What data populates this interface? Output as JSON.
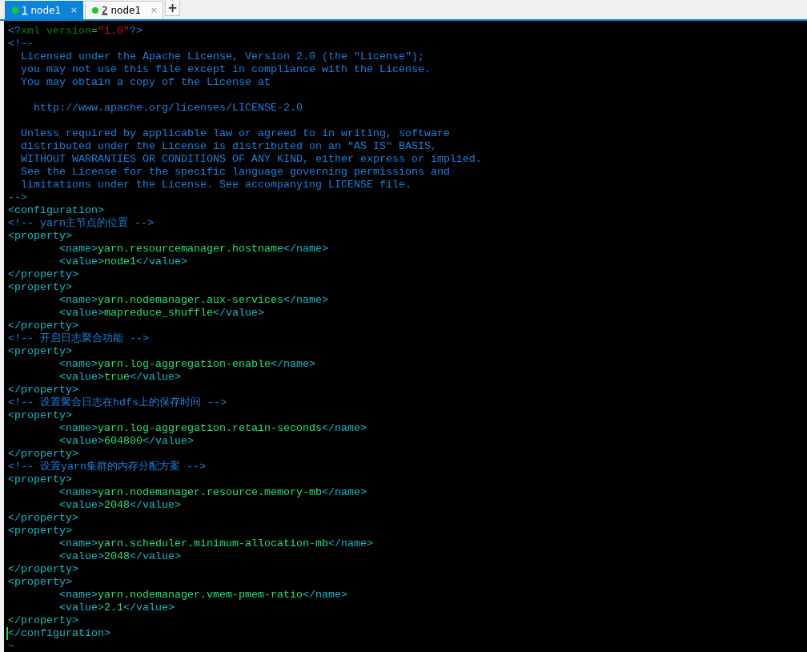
{
  "tabs": [
    {
      "number": "1",
      "label": "node1",
      "close": "×",
      "selected": true
    },
    {
      "number": "2",
      "label": "node1",
      "close": "×",
      "selected": false
    }
  ],
  "new_tab": "+",
  "editor": {
    "lines": [
      {
        "segments": [
          {
            "kind": "punct",
            "text": "<?"
          },
          {
            "kind": "attr",
            "text": "xml version"
          },
          {
            "kind": "eq",
            "text": "="
          },
          {
            "kind": "str",
            "text": "\"1.0\""
          },
          {
            "kind": "punct",
            "text": "?>"
          }
        ]
      },
      {
        "segments": [
          {
            "kind": "comment",
            "text": "<!--"
          }
        ]
      },
      {
        "segments": [
          {
            "kind": "comment",
            "text": "  Licensed under the Apache License, Version 2.0 (the \"License\");"
          }
        ]
      },
      {
        "segments": [
          {
            "kind": "comment",
            "text": "  you may not use this file except in compliance with the License."
          }
        ]
      },
      {
        "segments": [
          {
            "kind": "comment",
            "text": "  You may obtain a copy of the License at"
          }
        ]
      },
      {
        "blank_before": true,
        "segments": [
          {
            "kind": "comment",
            "text": "    http://www.apache.org/licenses/LICENSE-2.0"
          }
        ]
      },
      {
        "blank_before": true,
        "segments": [
          {
            "kind": "comment",
            "text": "  Unless required by applicable law or agreed to in writing, software"
          }
        ]
      },
      {
        "segments": [
          {
            "kind": "comment",
            "text": "  distributed under the License is distributed on an \"AS IS\" BASIS,"
          }
        ]
      },
      {
        "segments": [
          {
            "kind": "comment",
            "text": "  WITHOUT WARRANTIES OR CONDITIONS OF ANY KIND, either express or implied."
          }
        ]
      },
      {
        "segments": [
          {
            "kind": "comment",
            "text": "  See the License for the specific language governing permissions and"
          }
        ]
      },
      {
        "segments": [
          {
            "kind": "comment",
            "text": "  limitations under the License. See accompanying LICENSE file."
          }
        ]
      },
      {
        "segments": [
          {
            "kind": "comment",
            "text": "-->"
          }
        ]
      },
      {
        "segments": [
          {
            "kind": "tag",
            "text": "<configuration>"
          }
        ]
      },
      {
        "segments": [
          {
            "kind": "comment",
            "text": "<!-- yarn主节点的位置 -->"
          }
        ]
      },
      {
        "segments": [
          {
            "kind": "tag",
            "text": "<property>"
          }
        ]
      },
      {
        "segments": [
          {
            "kind": "tag",
            "text": "        <name>"
          },
          {
            "kind": "text",
            "text": "yarn.resourcemanager.hostname"
          },
          {
            "kind": "tag",
            "text": "</name>"
          }
        ]
      },
      {
        "segments": [
          {
            "kind": "tag",
            "text": "        <value>"
          },
          {
            "kind": "text",
            "text": "node1"
          },
          {
            "kind": "tag",
            "text": "</value>"
          }
        ]
      },
      {
        "segments": [
          {
            "kind": "tag",
            "text": "</property>"
          }
        ]
      },
      {
        "segments": [
          {
            "kind": "tag",
            "text": "<property>"
          }
        ]
      },
      {
        "segments": [
          {
            "kind": "tag",
            "text": "        <name>"
          },
          {
            "kind": "text",
            "text": "yarn.nodemanager.aux-services"
          },
          {
            "kind": "tag",
            "text": "</name>"
          }
        ]
      },
      {
        "segments": [
          {
            "kind": "tag",
            "text": "        <value>"
          },
          {
            "kind": "text",
            "text": "mapreduce_shuffle"
          },
          {
            "kind": "tag",
            "text": "</value>"
          }
        ]
      },
      {
        "segments": [
          {
            "kind": "tag",
            "text": "</property>"
          }
        ]
      },
      {
        "segments": [
          {
            "kind": "comment",
            "text": "<!-- 开启日志聚合功能 -->"
          }
        ]
      },
      {
        "segments": [
          {
            "kind": "tag",
            "text": "<property>"
          }
        ]
      },
      {
        "segments": [
          {
            "kind": "tag",
            "text": "        <name>"
          },
          {
            "kind": "text",
            "text": "yarn.log-aggregation-enable"
          },
          {
            "kind": "tag",
            "text": "</name>"
          }
        ]
      },
      {
        "segments": [
          {
            "kind": "tag",
            "text": "        <value>"
          },
          {
            "kind": "text",
            "text": "true"
          },
          {
            "kind": "tag",
            "text": "</value>"
          }
        ]
      },
      {
        "segments": [
          {
            "kind": "tag",
            "text": "</property>"
          }
        ]
      },
      {
        "segments": [
          {
            "kind": "comment",
            "text": "<!-- 设置聚合日志在hdfs上的保存时间 -->"
          }
        ]
      },
      {
        "segments": [
          {
            "kind": "tag",
            "text": "<property>"
          }
        ]
      },
      {
        "segments": [
          {
            "kind": "tag",
            "text": "        <name>"
          },
          {
            "kind": "text",
            "text": "yarn.log-aggregation.retain-seconds"
          },
          {
            "kind": "tag",
            "text": "</name>"
          }
        ]
      },
      {
        "segments": [
          {
            "kind": "tag",
            "text": "        <value>"
          },
          {
            "kind": "text",
            "text": "604800"
          },
          {
            "kind": "tag",
            "text": "</value>"
          }
        ]
      },
      {
        "segments": [
          {
            "kind": "tag",
            "text": "</property>"
          }
        ]
      },
      {
        "segments": [
          {
            "kind": "comment",
            "text": "<!-- 设置yarn集群的内存分配方案 -->"
          }
        ]
      },
      {
        "segments": [
          {
            "kind": "tag",
            "text": "<property>"
          }
        ]
      },
      {
        "segments": [
          {
            "kind": "tag",
            "text": "        <name>"
          },
          {
            "kind": "text",
            "text": "yarn.nodemanager.resource.memory-mb"
          },
          {
            "kind": "tag",
            "text": "</name>"
          }
        ]
      },
      {
        "segments": [
          {
            "kind": "tag",
            "text": "        <value>"
          },
          {
            "kind": "text",
            "text": "2048"
          },
          {
            "kind": "tag",
            "text": "</value>"
          }
        ]
      },
      {
        "segments": [
          {
            "kind": "tag",
            "text": "</property>"
          }
        ]
      },
      {
        "segments": [
          {
            "kind": "tag",
            "text": "<property>"
          }
        ]
      },
      {
        "segments": [
          {
            "kind": "tag",
            "text": "        <name>"
          },
          {
            "kind": "text",
            "text": "yarn.scheduler.minimum-allocation-mb"
          },
          {
            "kind": "tag",
            "text": "</name>"
          }
        ]
      },
      {
        "segments": [
          {
            "kind": "tag",
            "text": "        <value>"
          },
          {
            "kind": "text",
            "text": "2048"
          },
          {
            "kind": "tag",
            "text": "</value>"
          }
        ]
      },
      {
        "segments": [
          {
            "kind": "tag",
            "text": "</property>"
          }
        ]
      },
      {
        "segments": [
          {
            "kind": "tag",
            "text": "<property>"
          }
        ]
      },
      {
        "segments": [
          {
            "kind": "tag",
            "text": "        <name>"
          },
          {
            "kind": "text",
            "text": "yarn.nodemanager.vmem-pmem-ratio"
          },
          {
            "kind": "tag",
            "text": "</name>"
          }
        ]
      },
      {
        "segments": [
          {
            "kind": "tag",
            "text": "        <value>"
          },
          {
            "kind": "text",
            "text": "2.1"
          },
          {
            "kind": "tag",
            "text": "</value>"
          }
        ]
      },
      {
        "segments": [
          {
            "kind": "tag",
            "text": "</property>"
          }
        ]
      },
      {
        "segments": [
          {
            "kind": "tag",
            "text": "</configuration>"
          }
        ],
        "cursor": true
      },
      {
        "segments": [
          {
            "kind": "tilde",
            "text": "~"
          }
        ]
      }
    ]
  }
}
